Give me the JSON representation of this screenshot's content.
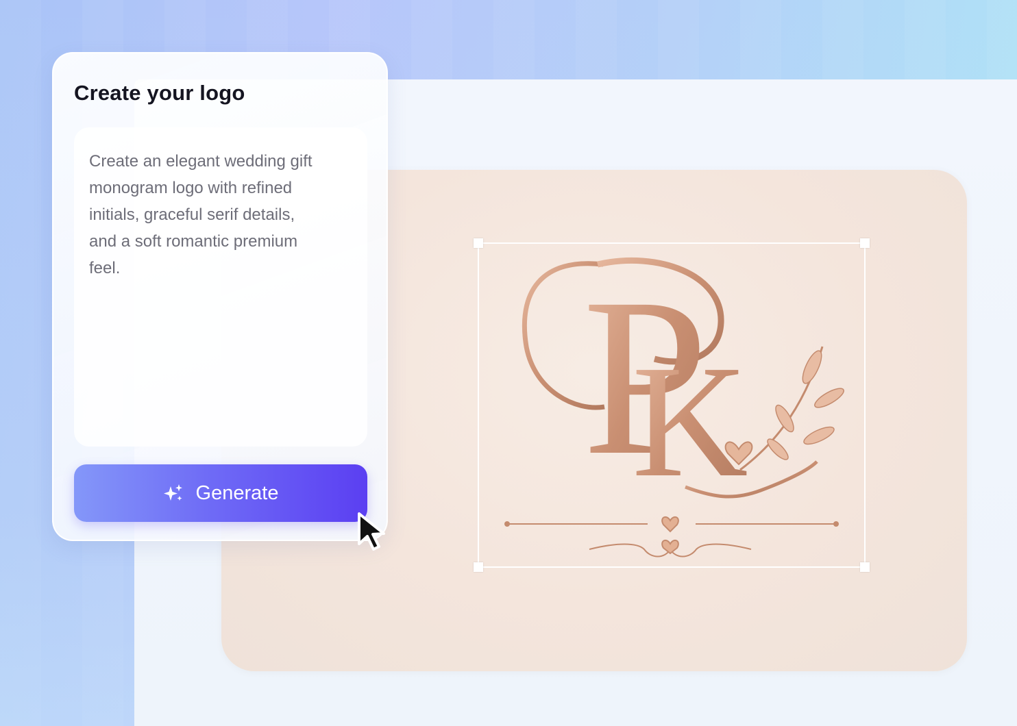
{
  "panel": {
    "title": "Create your logo",
    "prompt_text": "Create an elegant wedding gift monogram logo with refined initials, graceful serif details, and a soft romantic premium feel.",
    "generate_label": "Generate",
    "generate_icon": "sparkle-icon"
  },
  "canvas": {
    "monogram_letters": [
      "P",
      "K"
    ],
    "accent_color": "#c98f72",
    "background_color": "#f4e6dd"
  },
  "colors": {
    "button_start": "#8497f9",
    "button_end": "#5b3ff2",
    "title": "#151521",
    "prompt": "#6d6d78"
  },
  "cursor_icon": "arrow-cursor-icon"
}
